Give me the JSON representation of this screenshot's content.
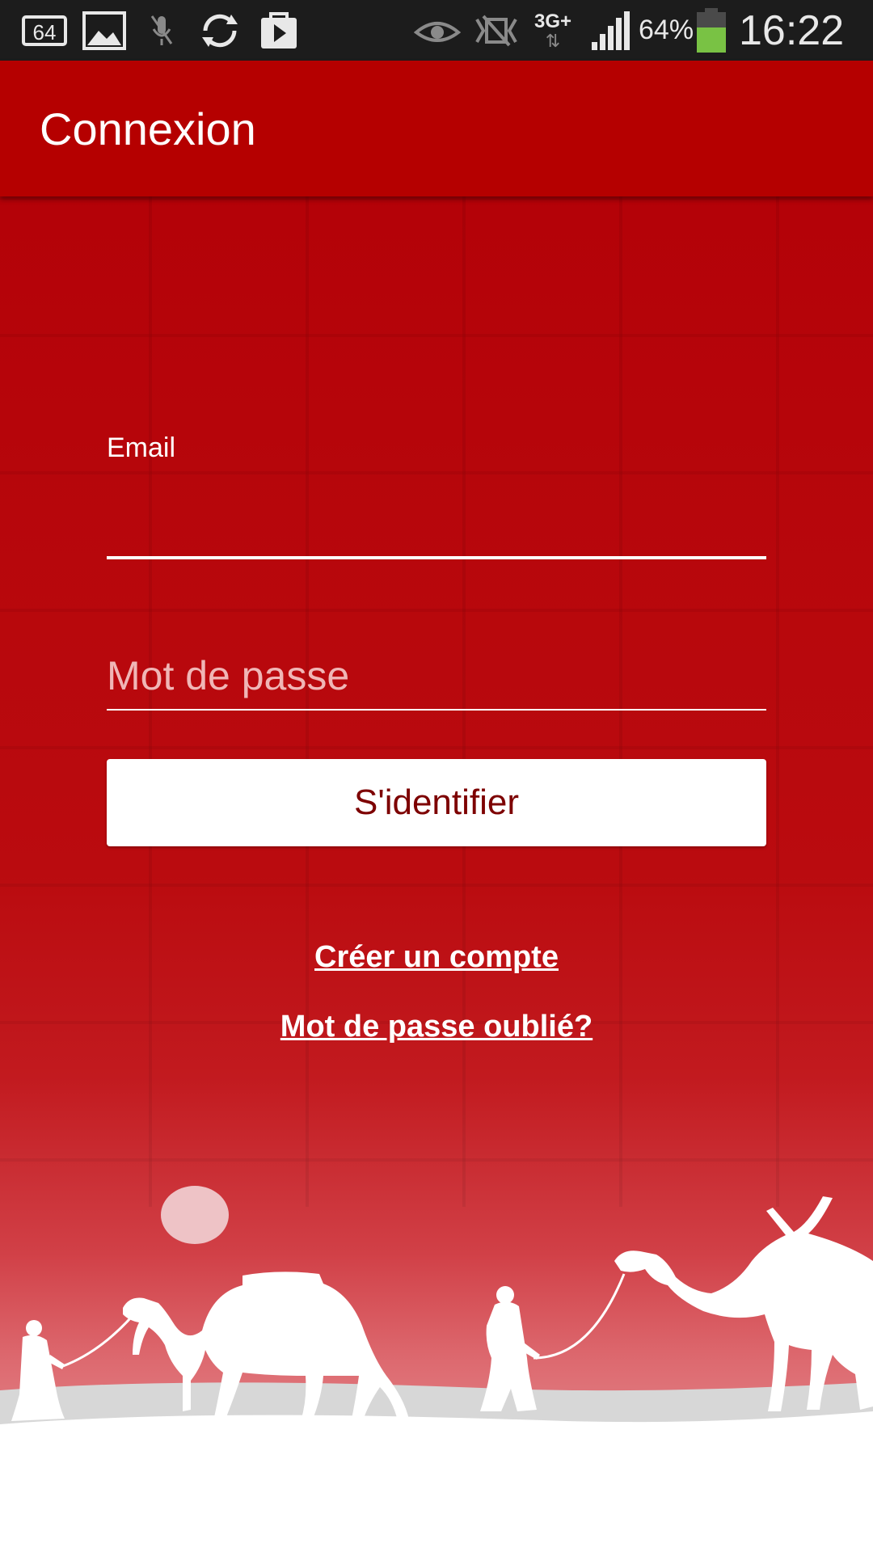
{
  "status_bar": {
    "notification_icons": [
      "storage-64-icon",
      "gallery-icon",
      "mic-muted-icon",
      "sync-icon",
      "play-store-icon"
    ],
    "system_icons": [
      "eye-icon",
      "nfc-muted-icon",
      "network-3g-plus-icon",
      "signal-icon",
      "battery-icon"
    ],
    "badge_64": "64",
    "network_type": "3G+",
    "battery_percent": "64%",
    "time": "16:22"
  },
  "app_bar": {
    "title": "Connexion"
  },
  "form": {
    "email_label": "Email",
    "email_value": "",
    "password_placeholder": "Mot de passe",
    "login_button": "S'identifier"
  },
  "links": {
    "create_account": "Créer un compte",
    "forgot_password": "Mot de passe oublié?"
  },
  "colors": {
    "brand_red": "#b50000",
    "button_text": "#7d0000",
    "status_bar": "#1c1c1c"
  },
  "illustration": {
    "icons": [
      "moon-icon",
      "camel-icon",
      "traveler-icon",
      "sand-dunes"
    ]
  }
}
